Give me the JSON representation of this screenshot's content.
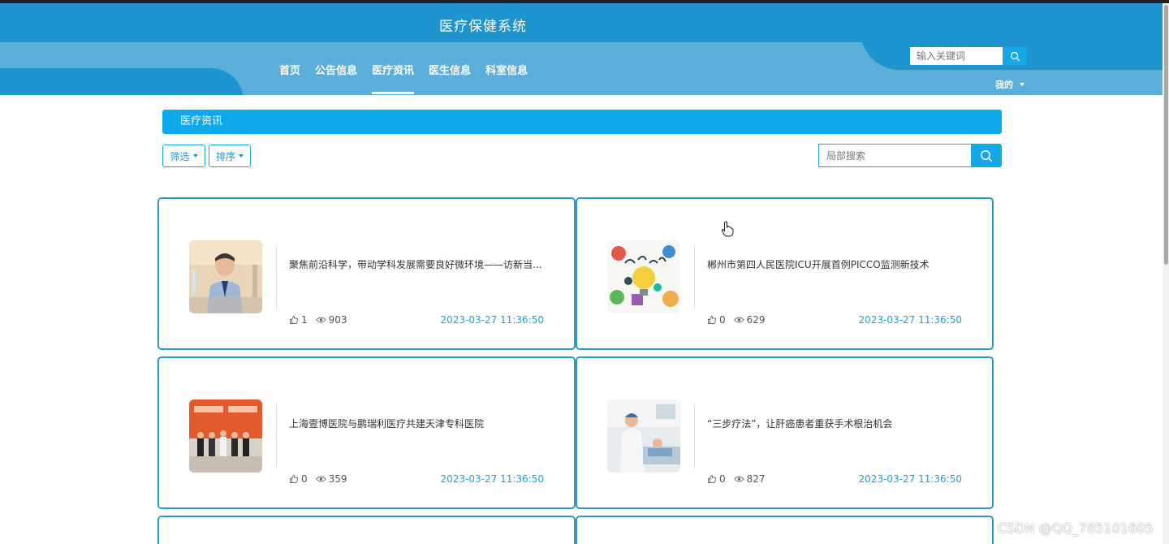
{
  "header": {
    "site_title": "医疗保健系统",
    "nav": [
      {
        "label": "首页",
        "active": false
      },
      {
        "label": "公告信息",
        "active": false
      },
      {
        "label": "医疗资讯",
        "active": true
      },
      {
        "label": "医生信息",
        "active": false
      },
      {
        "label": "科室信息",
        "active": false
      }
    ],
    "search_placeholder": "输入关键词",
    "user_menu_label": "我的"
  },
  "section": {
    "title": "医疗资讯",
    "filter_label": "筛选",
    "sort_label": "排序",
    "search_placeholder": "局部搜索"
  },
  "articles": [
    {
      "title": "聚焦前沿科学，带动学科发展需要良好微环境——访新当...",
      "likes": "1",
      "views": "903",
      "time": "2023-03-27 11:36:50",
      "image": "doctor-portrait"
    },
    {
      "title": "郴州市第四人民医院ICU开展首例PICCO监测新技术",
      "likes": "0",
      "views": "629",
      "time": "2023-03-27 11:36:50",
      "image": "learn-illustration"
    },
    {
      "title": "上海壹博医院与鹏瑞利医疗共建天津专科医院",
      "likes": "0",
      "views": "359",
      "time": "2023-03-27 11:36:50",
      "image": "signing-ceremony"
    },
    {
      "title": "“三步疗法”，让肝癌患者重获手术根治机会",
      "likes": "0",
      "views": "827",
      "time": "2023-03-27 11:36:50",
      "image": "hospital-ward"
    }
  ],
  "watermark": "CSDN @QQ_785101605",
  "colors": {
    "primary": "#1f95cf",
    "accent": "#0fa8ea",
    "header_light": "#5aaed8",
    "border": "#2a9ac8"
  }
}
